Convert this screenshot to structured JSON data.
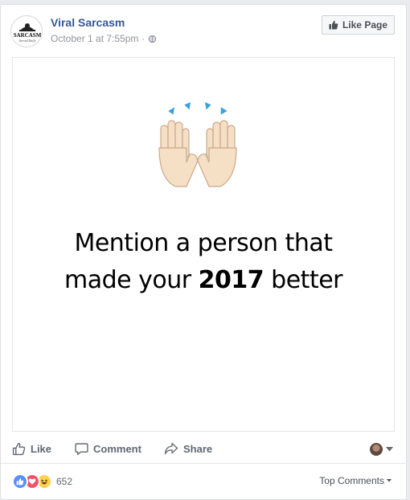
{
  "post": {
    "page_name": "Viral Sarcasm",
    "timestamp": "October 1 at 7:55pm",
    "separator": "·",
    "audience_icon": "globe-icon",
    "like_page_label": "Like Page",
    "avatar_text_top": "SARCASM",
    "avatar_text_bottom": "Served Daily"
  },
  "image": {
    "emoji": "raised-hands",
    "line1": "Mention a person that",
    "line2_pre": "made your ",
    "line2_bold": "2017",
    "line2_post": " better"
  },
  "actions": {
    "like": "Like",
    "comment": "Comment",
    "share": "Share"
  },
  "reactions": {
    "types": [
      "like",
      "love",
      "haha"
    ],
    "count": "652",
    "sort_label": "Top Comments"
  },
  "colors": {
    "link": "#365899",
    "meta": "#90949c",
    "like_blue": "#5890ff",
    "love_red": "#f25268",
    "haha_yellow": "#fcd24f"
  }
}
